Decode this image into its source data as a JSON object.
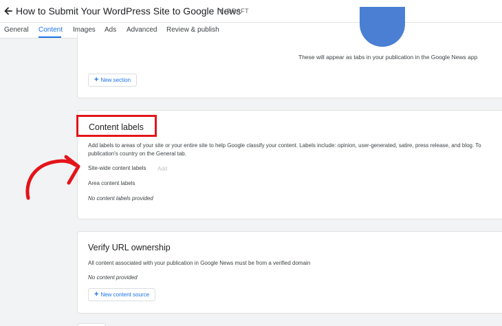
{
  "header": {
    "title": "How to Submit Your WordPress Site to Google News",
    "status": "DRAFT"
  },
  "tabs": [
    {
      "label": "General"
    },
    {
      "label": "Content"
    },
    {
      "label": "Images"
    },
    {
      "label": "Ads"
    },
    {
      "label": "Advanced"
    },
    {
      "label": "Review & publish"
    }
  ],
  "sections_card": {
    "note": "These will appear as tabs in your publication in the Google News app",
    "new_section_label": "New section"
  },
  "content_labels": {
    "title": "Content labels",
    "description_line1": "Add labels to areas of your site or your entire site to help Google classify your content. Labels include: opinion, user-generated, satire, press release, and blog. To",
    "description_line2": "publication's country on the General tab.",
    "site_wide_label": "Site-wide content labels",
    "add_label": "Add",
    "area_label": "Area content labels",
    "empty_text": "No content labels provided"
  },
  "verify_url": {
    "title": "Verify URL ownership",
    "description": "All content associated with your publication in Google News must be from a verified domain",
    "empty_text": "No content provided",
    "new_source_label": "New content source"
  },
  "colors": {
    "accent": "#1a73e8",
    "highlight": "#e3141a"
  }
}
